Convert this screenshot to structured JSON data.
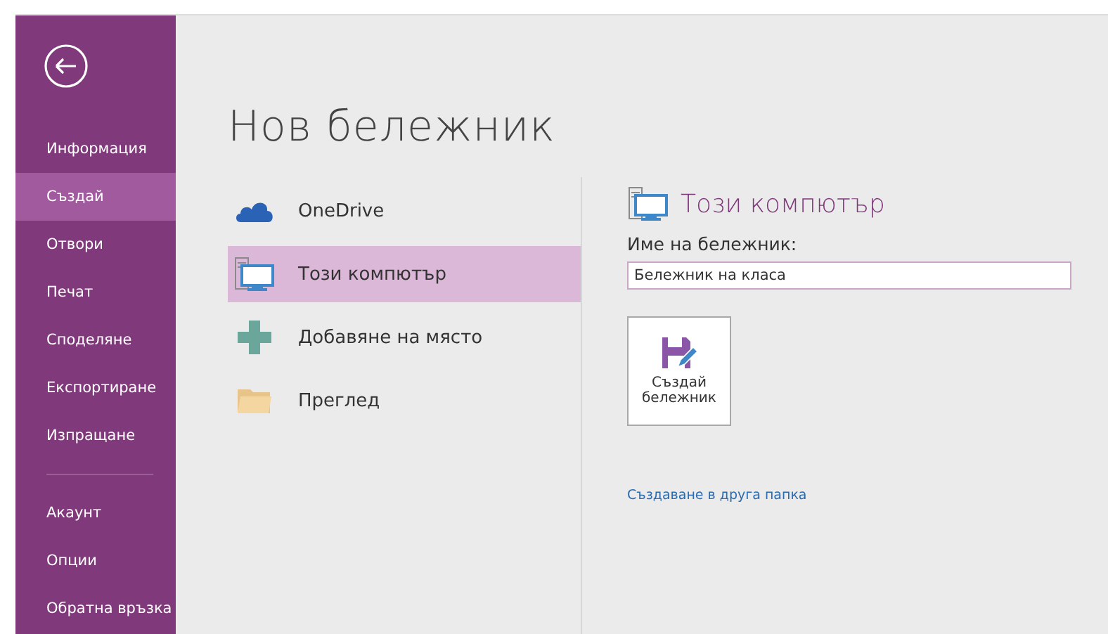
{
  "sidebar": {
    "items": [
      {
        "label": "Информация",
        "selected": false
      },
      {
        "label": "Създай",
        "selected": true
      },
      {
        "label": "Отвори",
        "selected": false
      },
      {
        "label": "Печат",
        "selected": false
      },
      {
        "label": "Споделяне",
        "selected": false
      },
      {
        "label": "Експортиране",
        "selected": false
      },
      {
        "label": "Изпращане",
        "selected": false
      }
    ],
    "bottom_items": [
      {
        "label": "Акаунт",
        "selected": false
      },
      {
        "label": "Опции",
        "selected": false
      },
      {
        "label": "Обратна връзка",
        "selected": false
      }
    ]
  },
  "title": "Нов бележник",
  "locations": [
    {
      "kind": "cloud",
      "label": "OneDrive",
      "selected": false
    },
    {
      "kind": "computer",
      "label": "Този компютър",
      "selected": true
    },
    {
      "kind": "add",
      "label": "Добавяне на място",
      "selected": false
    },
    {
      "kind": "folder",
      "label": "Преглед",
      "selected": false
    }
  ],
  "panel": {
    "heading": "Този компютър",
    "name_label": "Име на бележник:",
    "name_value": "Бележник на класа",
    "create_button": "Създай бележник",
    "other_folder_link": "Създаване в друга папка"
  }
}
